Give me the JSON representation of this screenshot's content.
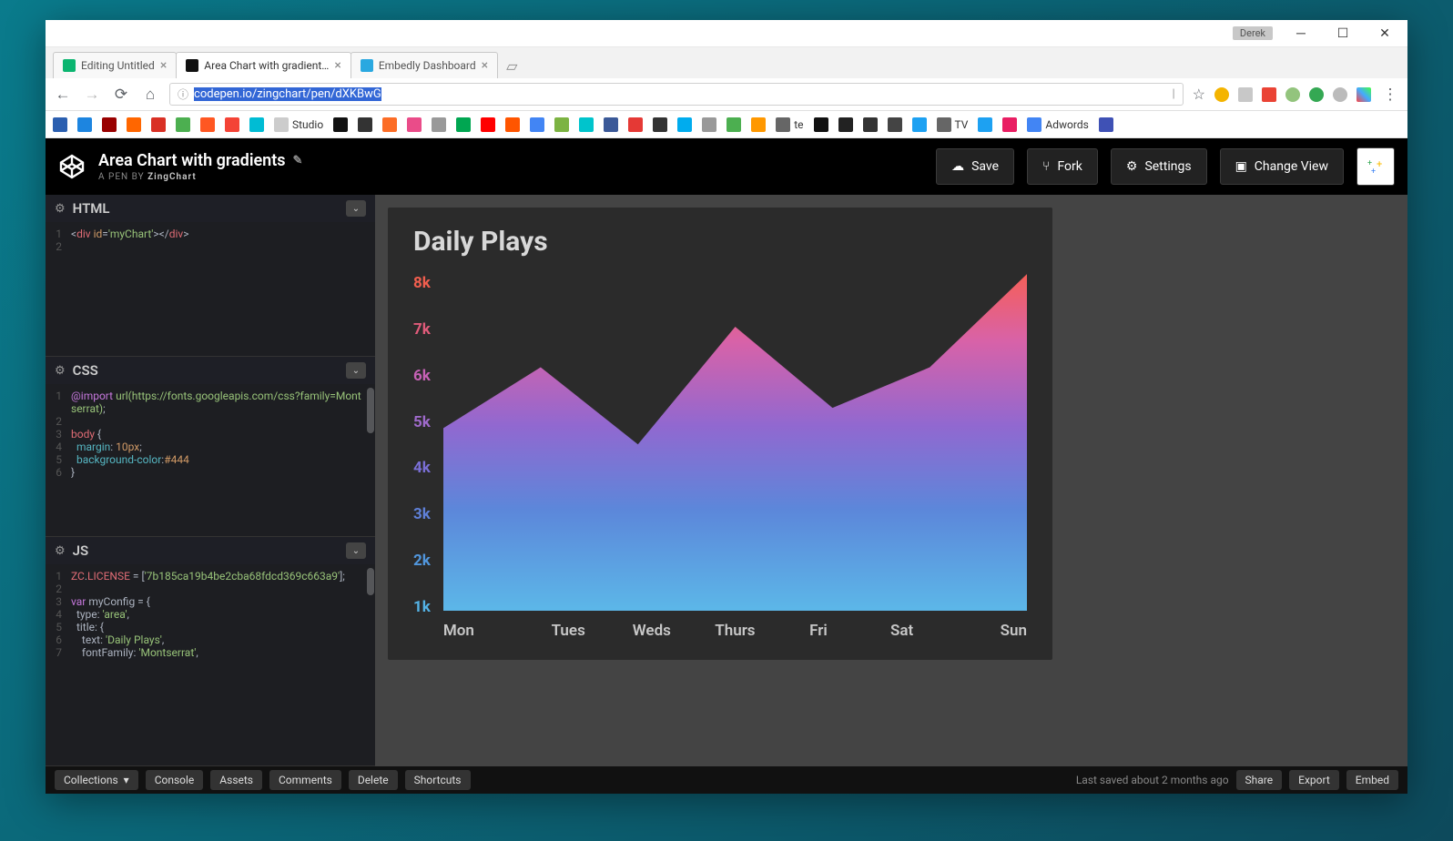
{
  "os": {
    "user_tag": "Derek"
  },
  "browser": {
    "tabs": [
      {
        "favicon": "#0bb570",
        "title": "Editing Untitled"
      },
      {
        "favicon": "#111",
        "title": "Area Chart with gradient…"
      },
      {
        "favicon": "#2aa8e0",
        "title": "Embedly Dashboard"
      }
    ],
    "active_tab": 1,
    "url_display": "codepen.io/zingchart/pen/dXKBwG",
    "url_protocol_icon": "ⓘ"
  },
  "bookmarks": {
    "items": [
      {
        "c": "#2b5fb0"
      },
      {
        "c": "#1d85e0"
      },
      {
        "c": "#900"
      },
      {
        "c": "#ff6600"
      },
      {
        "c": "#d93025"
      },
      {
        "c": "#4caf50"
      },
      {
        "c": "#ff5722"
      },
      {
        "c": "#f44336"
      },
      {
        "c": "#00bcd4"
      },
      {
        "c": "#ccc",
        "t": "Studio"
      },
      {
        "c": "#111"
      },
      {
        "c": "#333"
      },
      {
        "c": "#fc6d26"
      },
      {
        "c": "#ea4c89"
      },
      {
        "c": "#999"
      },
      {
        "c": "#00a651"
      },
      {
        "c": "#ff0000"
      },
      {
        "c": "#ff5500"
      },
      {
        "c": "#4285f4",
        "u": "1"
      },
      {
        "c": "#7cb342"
      },
      {
        "c": "#00c4cc"
      },
      {
        "c": "#3b5998"
      },
      {
        "c": "#e53935"
      },
      {
        "c": "#333"
      },
      {
        "c": "#00acee"
      },
      {
        "c": "#999"
      },
      {
        "c": "#4caf50"
      },
      {
        "c": "#ff9800"
      },
      {
        "c": "#666",
        "t": "te"
      },
      {
        "c": "#111"
      },
      {
        "c": "#222"
      },
      {
        "c": "#333"
      },
      {
        "c": "#444"
      },
      {
        "c": "#1da1f2"
      },
      {
        "c": "#666",
        "t": "TV"
      },
      {
        "c": "#1da1f2"
      },
      {
        "c": "#e91e63"
      },
      {
        "c": "#4285f4",
        "t": "Adwords"
      },
      {
        "c": "#3f51b5"
      }
    ]
  },
  "codepen": {
    "title": "Area Chart with gradients",
    "byline_prefix": "A PEN BY ",
    "byline_author": "ZingChart",
    "buttons": {
      "save": "Save",
      "fork": "Fork",
      "settings": "Settings",
      "change_view": "Change View"
    },
    "editors": {
      "html": {
        "label": "HTML",
        "code": "<div id='myChart'></div>"
      },
      "css": {
        "label": "CSS",
        "lines": [
          "@import url(https://fonts.googleapis.com/css?family=Montserrat);",
          "",
          "body {",
          "  margin: 10px;",
          "  background-color:#444",
          "}"
        ]
      },
      "js": {
        "label": "JS",
        "lines": [
          "ZC.LICENSE = ['7b185ca19b4be2cba68fdcd369c663a9'];",
          "",
          "var myConfig = {",
          "  type: 'area',",
          "  title: {",
          "    text: 'Daily Plays',",
          "    fontFamily: 'Montserrat',"
        ]
      }
    },
    "footer": {
      "collections": "Collections",
      "console": "Console",
      "assets": "Assets",
      "comments": "Comments",
      "delete": "Delete",
      "shortcuts": "Shortcuts",
      "last_saved": "Last saved about 2 months ago",
      "share": "Share",
      "export": "Export",
      "embed": "Embed"
    }
  },
  "chart_data": {
    "type": "area",
    "title": "Daily Plays",
    "categories": [
      "Mon",
      "Tues",
      "Weds",
      "Thurs",
      "Fri",
      "Sat",
      "Sun"
    ],
    "values": [
      4.5,
      6.0,
      4.1,
      7.0,
      5.0,
      6.0,
      8.3
    ],
    "y_ticks": [
      8,
      7,
      6,
      5,
      4,
      3,
      2,
      1
    ],
    "y_tick_suffix": "k",
    "y_tick_colors": [
      "#f05e4e",
      "#e05b7a",
      "#c661b5",
      "#9f6acb",
      "#7a6fd5",
      "#5f80d8",
      "#5196dc",
      "#54b2e5"
    ],
    "ylim": [
      0,
      8.3
    ],
    "xlabel": "",
    "ylabel": ""
  }
}
